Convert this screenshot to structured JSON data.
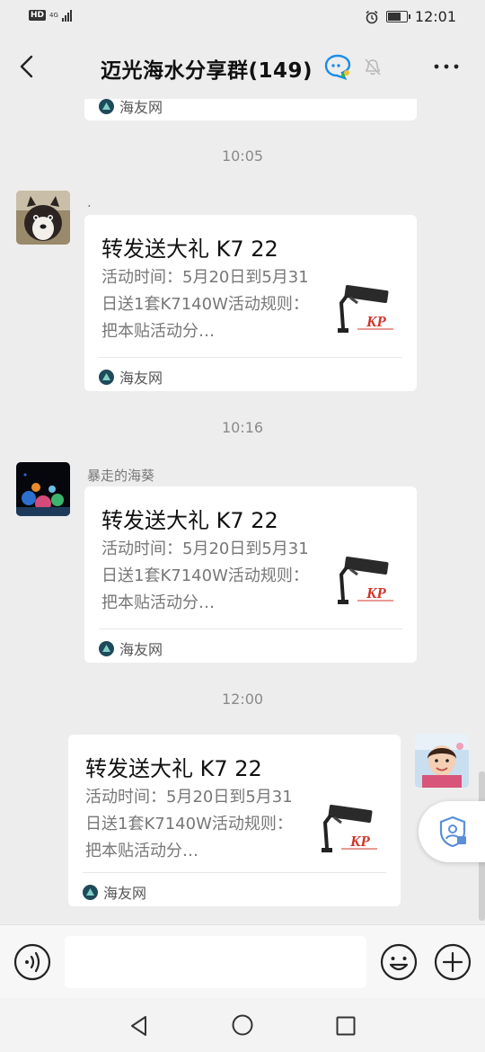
{
  "status_bar": {
    "hd": "HD",
    "network": "4G",
    "time": "12:01",
    "battery_level": 0.7
  },
  "header": {
    "title": "迈光海水分享群(149)",
    "back_icon": "chevron-left-icon",
    "ai_icon": "ai-assistant-icon",
    "mute_icon": "bell-muted-icon",
    "more_icon": "more-dots-icon"
  },
  "chat": {
    "top_card_source": "海友网",
    "messages": [
      {
        "time": "10:05",
        "sender": ".",
        "side": "left",
        "card": {
          "title": "转发送大礼 K7 22",
          "desc": "活动时间：5月20日到5月31日送1套K7140W活动规则：把本贴活动分…",
          "thumb_brand": "KP",
          "source": "海友网"
        }
      },
      {
        "time": "10:16",
        "sender": "暴走的海葵",
        "side": "left",
        "card": {
          "title": "转发送大礼 K7 22",
          "desc": "活动时间：5月20日到5月31日送1套K7140W活动规则：把本贴活动分…",
          "thumb_brand": "KP",
          "source": "海友网"
        }
      },
      {
        "time": "12:00",
        "sender": "",
        "side": "right",
        "card": {
          "title": "转发送大礼 K7 22",
          "desc": "活动时间：5月20日到5月31日送1套K7140W活动规则：把本贴活动分…",
          "thumb_brand": "KP",
          "source": "海友网"
        }
      }
    ]
  },
  "input_bar": {
    "voice_icon": "voice-icon",
    "placeholder": "",
    "emoji_icon": "emoji-icon",
    "plus_icon": "plus-icon"
  },
  "colors": {
    "background": "#ededed",
    "card": "#ffffff",
    "brand_red": "#d0342c",
    "time_gray": "#8a8a8a"
  }
}
